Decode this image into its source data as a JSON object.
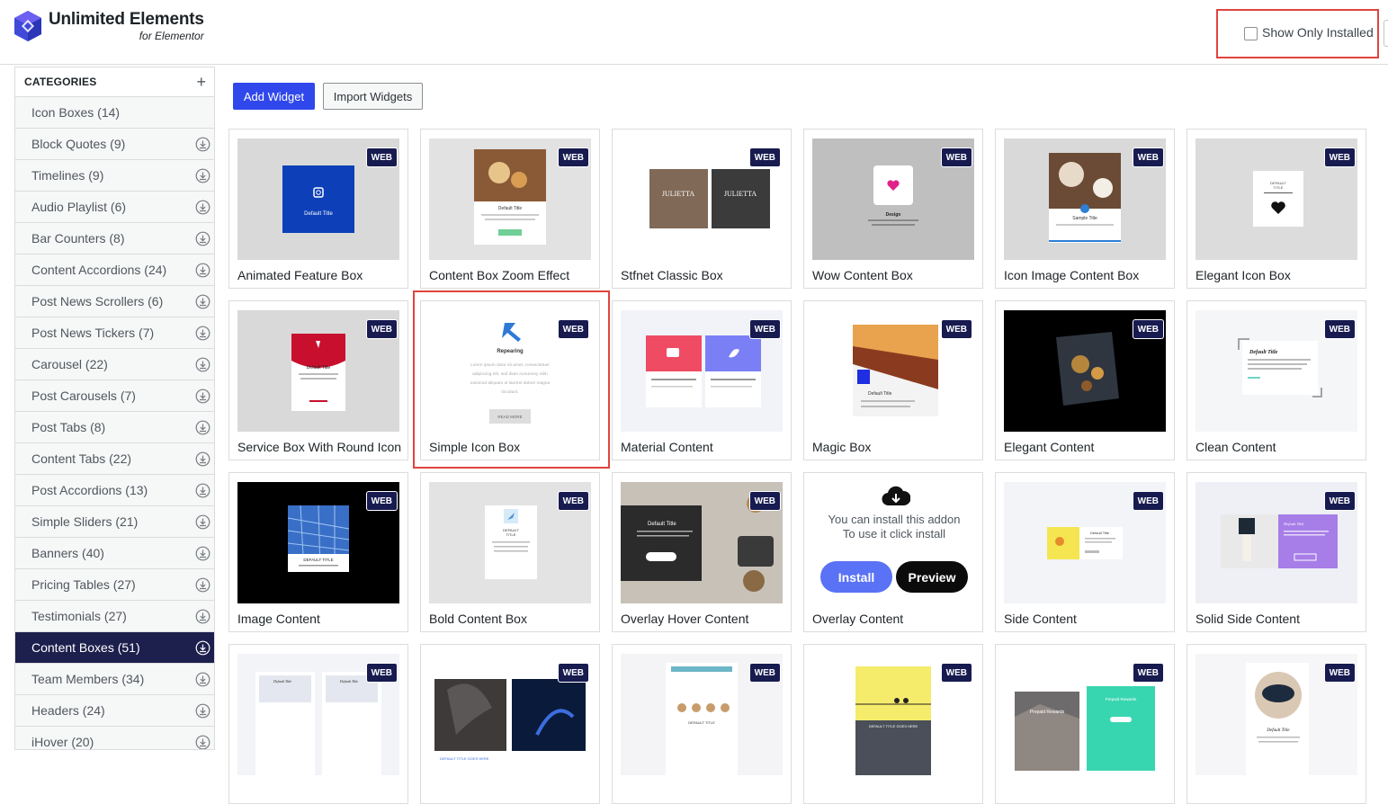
{
  "brand": {
    "title": "Unlimited Elements",
    "subtitle": "for Elementor",
    "accent": "#2f47eb"
  },
  "filter": {
    "show_only_installed_label": "Show Only Installed",
    "checked": false
  },
  "sidebar": {
    "heading": "CATEGORIES",
    "add_icon": "plus-icon",
    "items": [
      {
        "label": "Icon Boxes (14)",
        "download": false
      },
      {
        "label": "Block Quotes (9)",
        "download": true
      },
      {
        "label": "Timelines (9)",
        "download": true
      },
      {
        "label": "Audio Playlist (6)",
        "download": true
      },
      {
        "label": "Bar Counters (8)",
        "download": true
      },
      {
        "label": "Content Accordions (24)",
        "download": true
      },
      {
        "label": "Post News Scrollers (6)",
        "download": true
      },
      {
        "label": "Post News Tickers (7)",
        "download": true
      },
      {
        "label": "Carousel (22)",
        "download": true
      },
      {
        "label": "Post Carousels (7)",
        "download": true
      },
      {
        "label": "Post Tabs (8)",
        "download": true
      },
      {
        "label": "Content Tabs (22)",
        "download": true
      },
      {
        "label": "Post Accordions (13)",
        "download": true
      },
      {
        "label": "Simple Sliders (21)",
        "download": true
      },
      {
        "label": "Banners (40)",
        "download": true
      },
      {
        "label": "Pricing Tables (27)",
        "download": true
      },
      {
        "label": "Testimonials (27)",
        "download": true
      },
      {
        "label": "Content Boxes (51)",
        "download": true,
        "active": true
      },
      {
        "label": "Team Members (34)",
        "download": true
      },
      {
        "label": "Headers (24)",
        "download": true
      },
      {
        "label": "iHover (20)",
        "download": true
      }
    ]
  },
  "toolbar": {
    "add_widget": "Add Widget",
    "import_widgets": "Import Widgets"
  },
  "badge_label": "WEB",
  "widgets": [
    {
      "name": "Animated Feature Box"
    },
    {
      "name": "Content Box Zoom Effect"
    },
    {
      "name": "Stfnet Classic Box"
    },
    {
      "name": "Wow Content Box"
    },
    {
      "name": "Icon Image Content Box"
    },
    {
      "name": "Elegant Icon Box"
    },
    {
      "name": "Service Box With Round Icon"
    },
    {
      "name": "Simple Icon Box",
      "highlighted": true
    },
    {
      "name": "Material Content"
    },
    {
      "name": "Magic Box"
    },
    {
      "name": "Elegant Content"
    },
    {
      "name": "Clean Content"
    },
    {
      "name": "Image Content"
    },
    {
      "name": "Bold Content Box"
    },
    {
      "name": "Overlay Hover Content"
    },
    {
      "name": "Overlay Content",
      "not_installed": true
    },
    {
      "name": "Side Content"
    },
    {
      "name": "Solid Side Content"
    },
    {
      "name": ""
    },
    {
      "name": ""
    },
    {
      "name": ""
    },
    {
      "name": ""
    },
    {
      "name": ""
    },
    {
      "name": ""
    }
  ],
  "install_panel": {
    "line1": "You can install this addon",
    "line2": "To use it click install",
    "install": "Install",
    "preview": "Preview"
  },
  "thumb_text": {
    "default_title": "Default Title",
    "repearing": "Repearing",
    "lorem": "Lorem ipsum dolor sit amet, consectetuer adipiscing elit, sed diam nonummy nibh euismod aliquam ut laoreet dolore magna tincidunt.",
    "read_more": "READ MORE",
    "design": "Design",
    "julietta": "JULIETTA",
    "sample_title": "Sample Title",
    "prepaid_rewards": "Prepaid Rewards"
  }
}
